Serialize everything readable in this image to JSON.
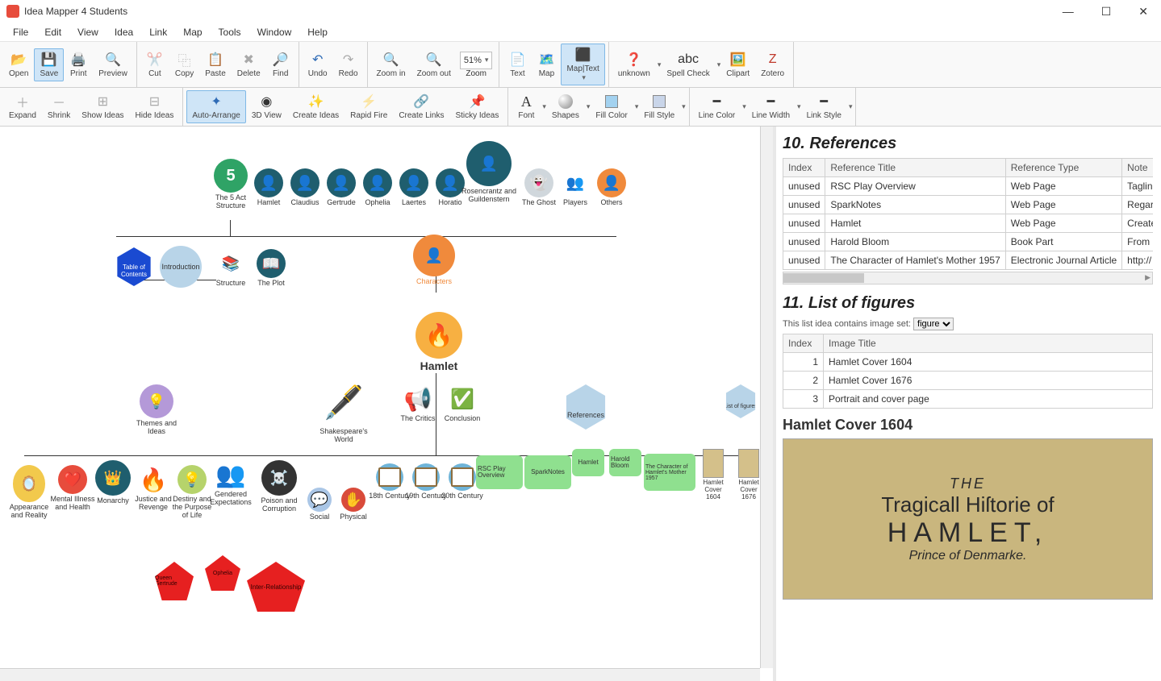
{
  "app_title": "Idea Mapper 4 Students",
  "menu": [
    "File",
    "Edit",
    "View",
    "Idea",
    "Link",
    "Map",
    "Tools",
    "Window",
    "Help"
  ],
  "toolbar1": {
    "open": "Open",
    "save": "Save",
    "print": "Print",
    "preview": "Preview",
    "cut": "Cut",
    "copy": "Copy",
    "paste": "Paste",
    "delete": "Delete",
    "find": "Find",
    "undo": "Undo",
    "redo": "Redo",
    "zoomin": "Zoom in",
    "zoomout": "Zoom out",
    "zoom_val": "51%",
    "zoom": "Zoom",
    "text": "Text",
    "map": "Map",
    "maptext": "Map|Text",
    "unknown": "unknown",
    "spell": "Spell Check",
    "clipart": "Clipart",
    "zotero": "Zotero"
  },
  "toolbar2": {
    "expand": "Expand",
    "shrink": "Shrink",
    "showideas": "Show Ideas",
    "hideideas": "Hide Ideas",
    "autoarrange": "Auto-Arrange",
    "view3d": "3D View",
    "createideas": "Create Ideas",
    "rapidfire": "Rapid Fire",
    "createlinks": "Create Links",
    "stickyideas": "Sticky Ideas",
    "font": "Font",
    "shapes": "Shapes",
    "fillcolor": "Fill Color",
    "fillstyle": "Fill Style",
    "linecolor": "Line Color",
    "linewidth": "Line Width",
    "linkstyle": "Link Style"
  },
  "map_nodes": {
    "five_act": "The 5 Act Structure",
    "hamlet_char": "Hamlet",
    "claudius": "Claudius",
    "gertrude": "Gertrude",
    "ophelia": "Ophelia",
    "laertes": "Laertes",
    "horatio": "Horatio",
    "rosencrantz": "Rosencrantz and Guildenstern",
    "ghost": "The Ghost",
    "players": "Players",
    "others": "Others",
    "toc": "Table of Contents",
    "intro": "Introduction",
    "structure": "Structure",
    "plot": "The Plot",
    "characters": "Characters",
    "hamlet_center": "Hamlet",
    "themes": "Themes and Ideas",
    "shakes_world": "Shakespeare's World",
    "critics": "The Critics",
    "conclusion": "Conclusion",
    "references": "References",
    "list_figures": "List of figures",
    "appearance": "Appearance and Reality",
    "mental": "Mental Illness and Health",
    "monarchy": "Monarchy",
    "justice": "Justice and Revenge",
    "destiny": "Destiny and the Purpose of Life",
    "gendered": "Gendered Expectations",
    "poison": "Poison and Corruption",
    "social": "Social",
    "physical": "Physical",
    "c18": "18th Century",
    "c19": "19th Century",
    "c20": "20th Century",
    "rsc": "RSC Play Overview",
    "spark": "SparkNotes",
    "hamlet_ref": "Hamlet",
    "bloom": "Harold Bloom",
    "mother": "The Character of Hamlet's Mother 1957",
    "cover1604": "Hamlet Cover 1604",
    "cover1676": "Hamlet Cover 1676",
    "queen_g": "Queen Gertrude",
    "ophelia2": "Ophelia",
    "inter": "Inter-Relationship"
  },
  "right": {
    "refs_heading": "10.  References",
    "refs_cols": {
      "index": "Index",
      "title": "Reference Title",
      "type": "Reference Type",
      "note": "Note"
    },
    "refs_rows": [
      {
        "idx": "unused",
        "title": "RSC Play Overview",
        "type": "Web Page",
        "note": "Tagline promin"
      },
      {
        "idx": "unused",
        "title": "SparkNotes",
        "type": "Web Page",
        "note": "Regard Hamlet"
      },
      {
        "idx": "unused",
        "title": "Hamlet",
        "type": "Web Page",
        "note": "Create Jeremy"
      },
      {
        "idx": "unused",
        "title": "Harold Bloom",
        "type": "Book Part",
        "note": "From I Archiv"
      },
      {
        "idx": "unused",
        "title": "The Character of Hamlet's Mother 1957",
        "type": "Electronic Journal Article",
        "note": "http:// www.js"
      }
    ],
    "figs_heading": "11.  List of figures",
    "fig_note": "This list idea contains image set:",
    "fig_select": "figure",
    "figs_cols": {
      "index": "Index",
      "title": "Image Title"
    },
    "figs_rows": [
      {
        "idx": "1",
        "title": "Hamlet Cover 1604"
      },
      {
        "idx": "2",
        "title": "Hamlet Cover 1676"
      },
      {
        "idx": "3",
        "title": "Portrait and cover page"
      }
    ],
    "img_heading": "Hamlet Cover 1604",
    "cover": {
      "l1": "THE",
      "l2": "Tragicall Hiſtorie of",
      "l3": "HAMLET,",
      "l4": "Prince of Denmarke."
    }
  }
}
